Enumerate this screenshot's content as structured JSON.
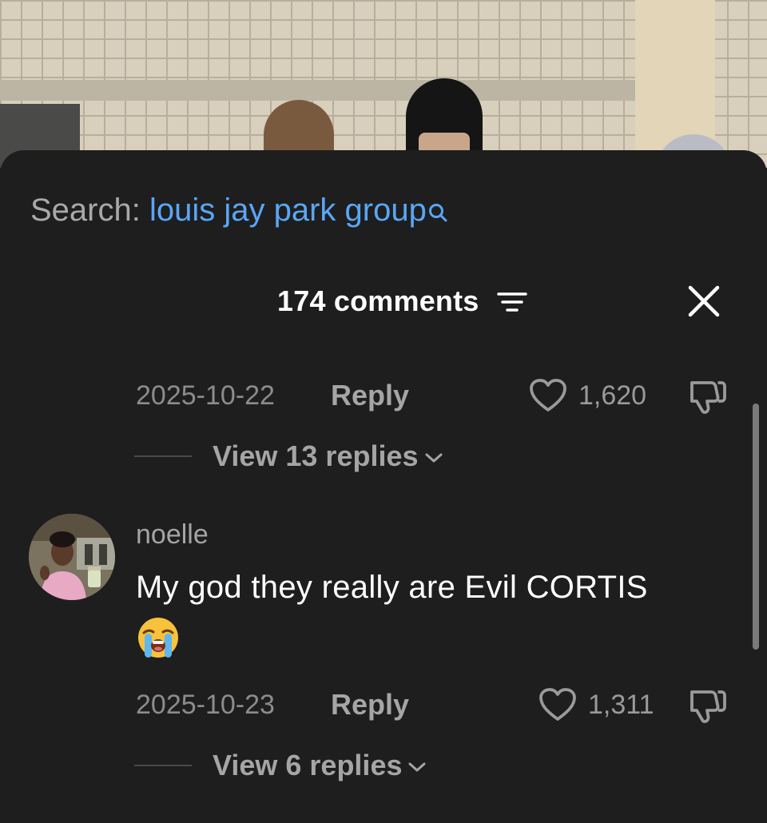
{
  "search": {
    "label": "Search:",
    "query": "louis jay park group",
    "icon": "search-icon"
  },
  "header": {
    "comment_count": "174 comments",
    "filter_icon": "filter-icon",
    "close_icon": "close-icon"
  },
  "comments": [
    {
      "date": "2025-10-22",
      "reply_label": "Reply",
      "likes": "1,620",
      "view_replies": "View 13 replies"
    },
    {
      "username": "noelle",
      "text": "My god they really are Evil CORTIS",
      "emoji": "loudly-crying-face-emoji",
      "date": "2025-10-23",
      "reply_label": "Reply",
      "likes": "1,311",
      "view_replies": "View 6 replies"
    }
  ],
  "colors": {
    "sheet_bg": "#1e1e1e",
    "link_blue": "#5aa6f5",
    "muted_text": "#8c8c8c",
    "primary_text": "#ffffff"
  }
}
